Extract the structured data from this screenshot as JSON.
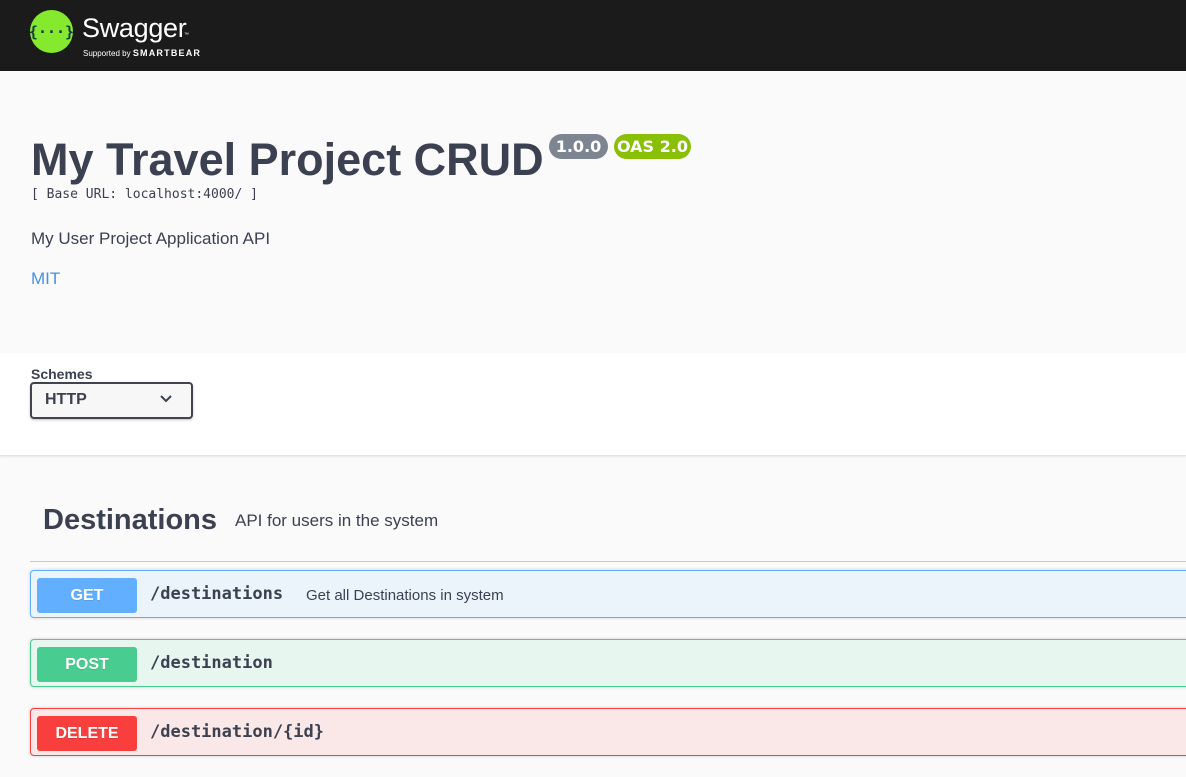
{
  "brand": {
    "name": "Swagger",
    "trademark": "™",
    "supported_by": "Supported by",
    "supporter": "SMARTBEAR",
    "logo_color": "#85ea2d"
  },
  "info": {
    "title": "My Travel Project CRUD",
    "version": "1.0.0",
    "spec_version": "OAS 2.0",
    "base_url": "[ Base URL: localhost:4000/ ]",
    "description": "My User Project Application API",
    "license": "MIT"
  },
  "schemes": {
    "label": "Schemes",
    "selected": "HTTP",
    "icon": "chevron-down-icon"
  },
  "tag": {
    "name": "Destinations",
    "description": "API for users in the system"
  },
  "operations": [
    {
      "method": "GET",
      "path": "/destinations",
      "summary": "Get all Destinations in system",
      "color": "#61affe"
    },
    {
      "method": "POST",
      "path": "/destination",
      "summary": "",
      "color": "#49cc90"
    },
    {
      "method": "DELETE",
      "path": "/destination/{id}",
      "summary": "",
      "color": "#f93e3e"
    }
  ]
}
